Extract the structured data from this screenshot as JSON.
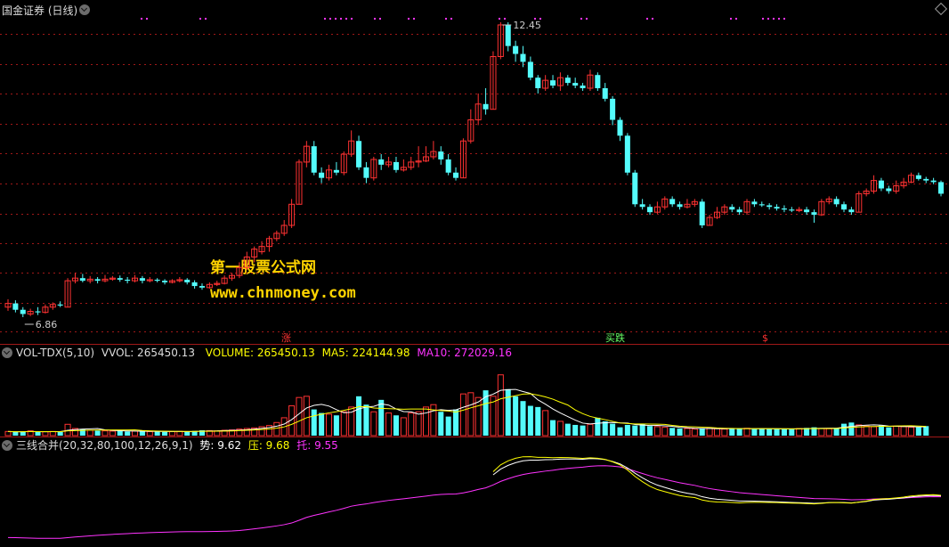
{
  "main_panel": {
    "title": "国金证券 (日线)",
    "watermark_title": "第一股票公式网",
    "watermark_url": "www.chnmoney.com",
    "labels": {
      "high": "12.45",
      "low": "6.86"
    },
    "signals": {
      "rise": "涨",
      "buy_fall": "买跌",
      "sell": "$"
    }
  },
  "vol_panel": {
    "name": "VOL-TDX(5,10)",
    "vvol": "VVOL: 265450.13",
    "volume": "VOLUME: 265450.13",
    "ma5": "MA5: 224144.98",
    "ma10": "MA10: 272029.16"
  },
  "line_panel": {
    "name": "三线合并(20,32,80,100,12,26,9,1)",
    "shi": "势: 9.62",
    "ya": "压: 9.68",
    "tuo": "托: 9.55"
  },
  "colors": {
    "up": "#ff3232",
    "down": "#54fcfc",
    "ma5": "#ffffff",
    "ma10": "#ffff00",
    "purple": "#ff33ff",
    "grid": "#a01818",
    "header_yellow": "#ffff00"
  },
  "chart_data": [
    {
      "type": "candlestick",
      "title": "国金证券 (日线)",
      "ylim": [
        6.86,
        12.45
      ],
      "max_label": 12.45,
      "min_label": 6.86,
      "candles": [
        [
          7.05,
          7.12,
          7.2,
          6.98
        ],
        [
          7.12,
          7.0,
          7.18,
          6.95
        ],
        [
          7.0,
          6.92,
          7.05,
          6.86
        ],
        [
          6.92,
          6.97,
          7.02,
          6.88
        ],
        [
          6.97,
          6.95,
          7.05,
          6.9
        ],
        [
          6.95,
          7.05,
          7.1,
          6.93
        ],
        [
          7.05,
          7.1,
          7.14,
          7.0
        ],
        [
          7.1,
          7.08,
          7.16,
          7.05
        ],
        [
          7.05,
          7.55,
          7.6,
          7.05
        ],
        [
          7.55,
          7.6,
          7.7,
          7.5
        ],
        [
          7.6,
          7.55,
          7.68,
          7.52
        ],
        [
          7.55,
          7.58,
          7.64,
          7.5
        ],
        [
          7.58,
          7.55,
          7.62,
          7.5
        ],
        [
          7.55,
          7.58,
          7.66,
          7.52
        ],
        [
          7.58,
          7.6,
          7.64,
          7.55
        ],
        [
          7.6,
          7.57,
          7.65,
          7.53
        ],
        [
          7.57,
          7.55,
          7.62,
          7.5
        ],
        [
          7.55,
          7.6,
          7.66,
          7.52
        ],
        [
          7.6,
          7.55,
          7.64,
          7.5
        ],
        [
          7.55,
          7.57,
          7.62,
          7.52
        ],
        [
          7.57,
          7.55,
          7.6,
          7.52
        ],
        [
          7.55,
          7.52,
          7.58,
          7.48
        ],
        [
          7.52,
          7.55,
          7.58,
          7.5
        ],
        [
          7.55,
          7.57,
          7.62,
          7.52
        ],
        [
          7.57,
          7.52,
          7.6,
          7.48
        ],
        [
          7.52,
          7.45,
          7.56,
          7.4
        ],
        [
          7.45,
          7.42,
          7.5,
          7.38
        ],
        [
          7.42,
          7.48,
          7.52,
          7.4
        ],
        [
          7.48,
          7.5,
          7.55,
          7.45
        ],
        [
          7.5,
          7.6,
          7.65,
          7.48
        ],
        [
          7.6,
          7.65,
          7.7,
          7.55
        ],
        [
          7.65,
          7.8,
          7.9,
          7.6
        ],
        [
          7.8,
          8.0,
          8.1,
          7.75
        ],
        [
          8.0,
          8.15,
          8.2,
          7.9
        ],
        [
          8.1,
          8.2,
          8.3,
          8.05
        ],
        [
          8.2,
          8.35,
          8.4,
          8.1
        ],
        [
          8.35,
          8.45,
          8.5,
          8.3
        ],
        [
          8.45,
          8.6,
          8.7,
          8.4
        ],
        [
          8.6,
          9.0,
          9.1,
          8.55
        ],
        [
          9.0,
          9.8,
          9.85,
          9.0
        ],
        [
          9.8,
          10.1,
          10.2,
          9.7
        ],
        [
          10.1,
          9.6,
          10.2,
          9.55
        ],
        [
          9.6,
          9.5,
          9.7,
          9.4
        ],
        [
          9.5,
          9.65,
          9.75,
          9.45
        ],
        [
          9.65,
          9.6,
          9.8,
          9.55
        ],
        [
          9.6,
          9.95,
          10.0,
          9.55
        ],
        [
          9.95,
          10.2,
          10.4,
          9.9
        ],
        [
          10.2,
          9.7,
          10.3,
          9.65
        ],
        [
          9.7,
          9.5,
          9.8,
          9.4
        ],
        [
          9.5,
          9.85,
          9.9,
          9.45
        ],
        [
          9.85,
          9.75,
          9.95,
          9.65
        ],
        [
          9.75,
          9.8,
          9.9,
          9.7
        ],
        [
          9.8,
          9.65,
          9.9,
          9.6
        ],
        [
          9.65,
          9.7,
          9.85,
          9.62
        ],
        [
          9.7,
          9.8,
          9.9,
          9.65
        ],
        [
          9.8,
          9.82,
          10.1,
          9.7
        ],
        [
          9.82,
          9.9,
          10.1,
          9.8
        ],
        [
          9.9,
          10.0,
          10.2,
          9.85
        ],
        [
          10.0,
          9.85,
          10.1,
          9.75
        ],
        [
          9.85,
          9.6,
          9.95,
          9.55
        ],
        [
          9.6,
          9.5,
          9.7,
          9.45
        ],
        [
          9.5,
          10.2,
          10.25,
          9.5
        ],
        [
          10.2,
          10.6,
          10.8,
          10.15
        ],
        [
          10.6,
          10.9,
          11.1,
          10.5
        ],
        [
          10.9,
          10.8,
          11.2,
          10.7
        ],
        [
          10.8,
          11.8,
          11.9,
          10.8
        ],
        [
          11.8,
          12.4,
          12.45,
          11.75
        ],
        [
          12.4,
          12.0,
          12.45,
          11.9
        ],
        [
          12.0,
          11.85,
          12.1,
          11.7
        ],
        [
          11.85,
          11.7,
          12.0,
          11.6
        ],
        [
          11.7,
          11.4,
          11.8,
          11.35
        ],
        [
          11.4,
          11.2,
          11.45,
          11.1
        ],
        [
          11.2,
          11.35,
          11.45,
          11.15
        ],
        [
          11.35,
          11.25,
          11.45,
          11.2
        ],
        [
          11.25,
          11.4,
          11.5,
          11.15
        ],
        [
          11.4,
          11.3,
          11.45,
          11.25
        ],
        [
          11.3,
          11.25,
          11.4,
          11.2
        ],
        [
          11.25,
          11.2,
          11.3,
          11.15
        ],
        [
          11.2,
          11.45,
          11.55,
          11.15
        ],
        [
          11.45,
          11.2,
          11.5,
          11.15
        ],
        [
          11.2,
          11.0,
          11.3,
          10.95
        ],
        [
          11.0,
          10.6,
          11.05,
          10.5
        ],
        [
          10.6,
          10.3,
          10.65,
          10.2
        ],
        [
          10.3,
          9.6,
          10.35,
          9.55
        ],
        [
          9.6,
          9.0,
          9.65,
          8.95
        ],
        [
          9.0,
          8.95,
          9.1,
          8.9
        ],
        [
          8.95,
          8.85,
          9.0,
          8.8
        ],
        [
          8.85,
          8.95,
          9.05,
          8.82
        ],
        [
          8.95,
          9.1,
          9.15,
          8.9
        ],
        [
          9.1,
          9.0,
          9.15,
          8.95
        ],
        [
          9.0,
          8.95,
          9.05,
          8.9
        ],
        [
          8.95,
          9.0,
          9.1,
          8.92
        ],
        [
          9.0,
          9.05,
          9.1,
          8.95
        ],
        [
          9.05,
          8.6,
          9.1,
          8.55
        ],
        [
          8.6,
          8.75,
          8.8,
          8.6
        ],
        [
          8.75,
          8.85,
          8.95,
          8.72
        ],
        [
          8.85,
          8.95,
          9.0,
          8.8
        ],
        [
          8.95,
          8.9,
          9.0,
          8.85
        ],
        [
          8.9,
          8.85,
          8.95,
          8.8
        ],
        [
          8.85,
          9.05,
          9.1,
          8.8
        ],
        [
          9.05,
          9.0,
          9.1,
          8.95
        ],
        [
          9.0,
          8.98,
          9.05,
          8.95
        ],
        [
          8.98,
          8.95,
          9.02,
          8.9
        ],
        [
          8.95,
          8.92,
          9.0,
          8.88
        ],
        [
          8.92,
          8.9,
          8.98,
          8.85
        ],
        [
          8.9,
          8.88,
          8.95,
          8.85
        ],
        [
          8.88,
          8.9,
          8.95,
          8.85
        ],
        [
          8.9,
          8.85,
          8.95,
          8.8
        ],
        [
          8.85,
          8.8,
          8.9,
          8.65
        ],
        [
          8.8,
          9.05,
          9.1,
          8.78
        ],
        [
          9.05,
          9.1,
          9.15,
          9.0
        ],
        [
          9.1,
          9.0,
          9.15,
          8.95
        ],
        [
          9.0,
          8.9,
          9.05,
          8.85
        ],
        [
          8.9,
          8.85,
          8.95,
          8.8
        ],
        [
          8.85,
          9.2,
          9.25,
          8.85
        ],
        [
          9.2,
          9.25,
          9.3,
          9.15
        ],
        [
          9.25,
          9.45,
          9.55,
          9.2
        ],
        [
          9.45,
          9.3,
          9.5,
          9.25
        ],
        [
          9.3,
          9.25,
          9.35,
          9.2
        ],
        [
          9.25,
          9.35,
          9.45,
          9.2
        ],
        [
          9.35,
          9.42,
          9.5,
          9.3
        ],
        [
          9.42,
          9.55,
          9.6,
          9.4
        ],
        [
          9.55,
          9.48,
          9.6,
          9.45
        ],
        [
          9.48,
          9.45,
          9.52,
          9.4
        ],
        [
          9.45,
          9.42,
          9.5,
          9.38
        ],
        [
          9.42,
          9.2,
          9.45,
          9.15
        ]
      ]
    },
    {
      "type": "bar",
      "title": "VOL-TDX(5,10)",
      "series": [
        {
          "name": "VOLUME"
        },
        {
          "name": "MA5"
        },
        {
          "name": "MA10"
        }
      ],
      "ylim": [
        0,
        650000
      ],
      "values": [
        35000,
        30000,
        32000,
        40000,
        30000,
        33000,
        35000,
        30000,
        95000,
        60000,
        55000,
        45000,
        42000,
        40000,
        38000,
        40000,
        35000,
        38000,
        36000,
        34000,
        35000,
        32000,
        34000,
        36000,
        33000,
        40000,
        45000,
        42000,
        40000,
        45000,
        48000,
        55000,
        60000,
        65000,
        75000,
        85000,
        110000,
        150000,
        250000,
        320000,
        330000,
        220000,
        190000,
        180000,
        170000,
        200000,
        240000,
        330000,
        260000,
        200000,
        300000,
        190000,
        170000,
        150000,
        190000,
        200000,
        240000,
        260000,
        200000,
        160000,
        220000,
        350000,
        360000,
        320000,
        380000,
        330000,
        510000,
        390000,
        330000,
        290000,
        250000,
        240000,
        210000,
        130000,
        120000,
        100000,
        90000,
        85000,
        95000,
        150000,
        120000,
        100000,
        70000,
        90000,
        85000,
        100000,
        80000,
        75000,
        70000,
        65000,
        60000,
        60000,
        55000,
        60000,
        62000,
        58000,
        55000,
        60000,
        58000,
        62000,
        55000,
        60000,
        55000,
        58000,
        55000,
        55000,
        60000,
        65000,
        70000,
        60000,
        58000,
        60000,
        100000,
        110000,
        90000,
        80000,
        75000,
        85000,
        70000,
        80000,
        75000,
        70000,
        70000,
        80000
      ],
      "MA5": 224144.98,
      "MA10": 272029.16,
      "VVOL": 265450.13,
      "VOLUME": 265450.13
    },
    {
      "type": "line",
      "title": "三线合并(20,32,80,100,12,26,9,1)",
      "series": [
        {
          "name": "势",
          "last": 9.62
        },
        {
          "name": "压",
          "last": 9.68
        },
        {
          "name": "托",
          "last": 9.55
        }
      ]
    }
  ]
}
